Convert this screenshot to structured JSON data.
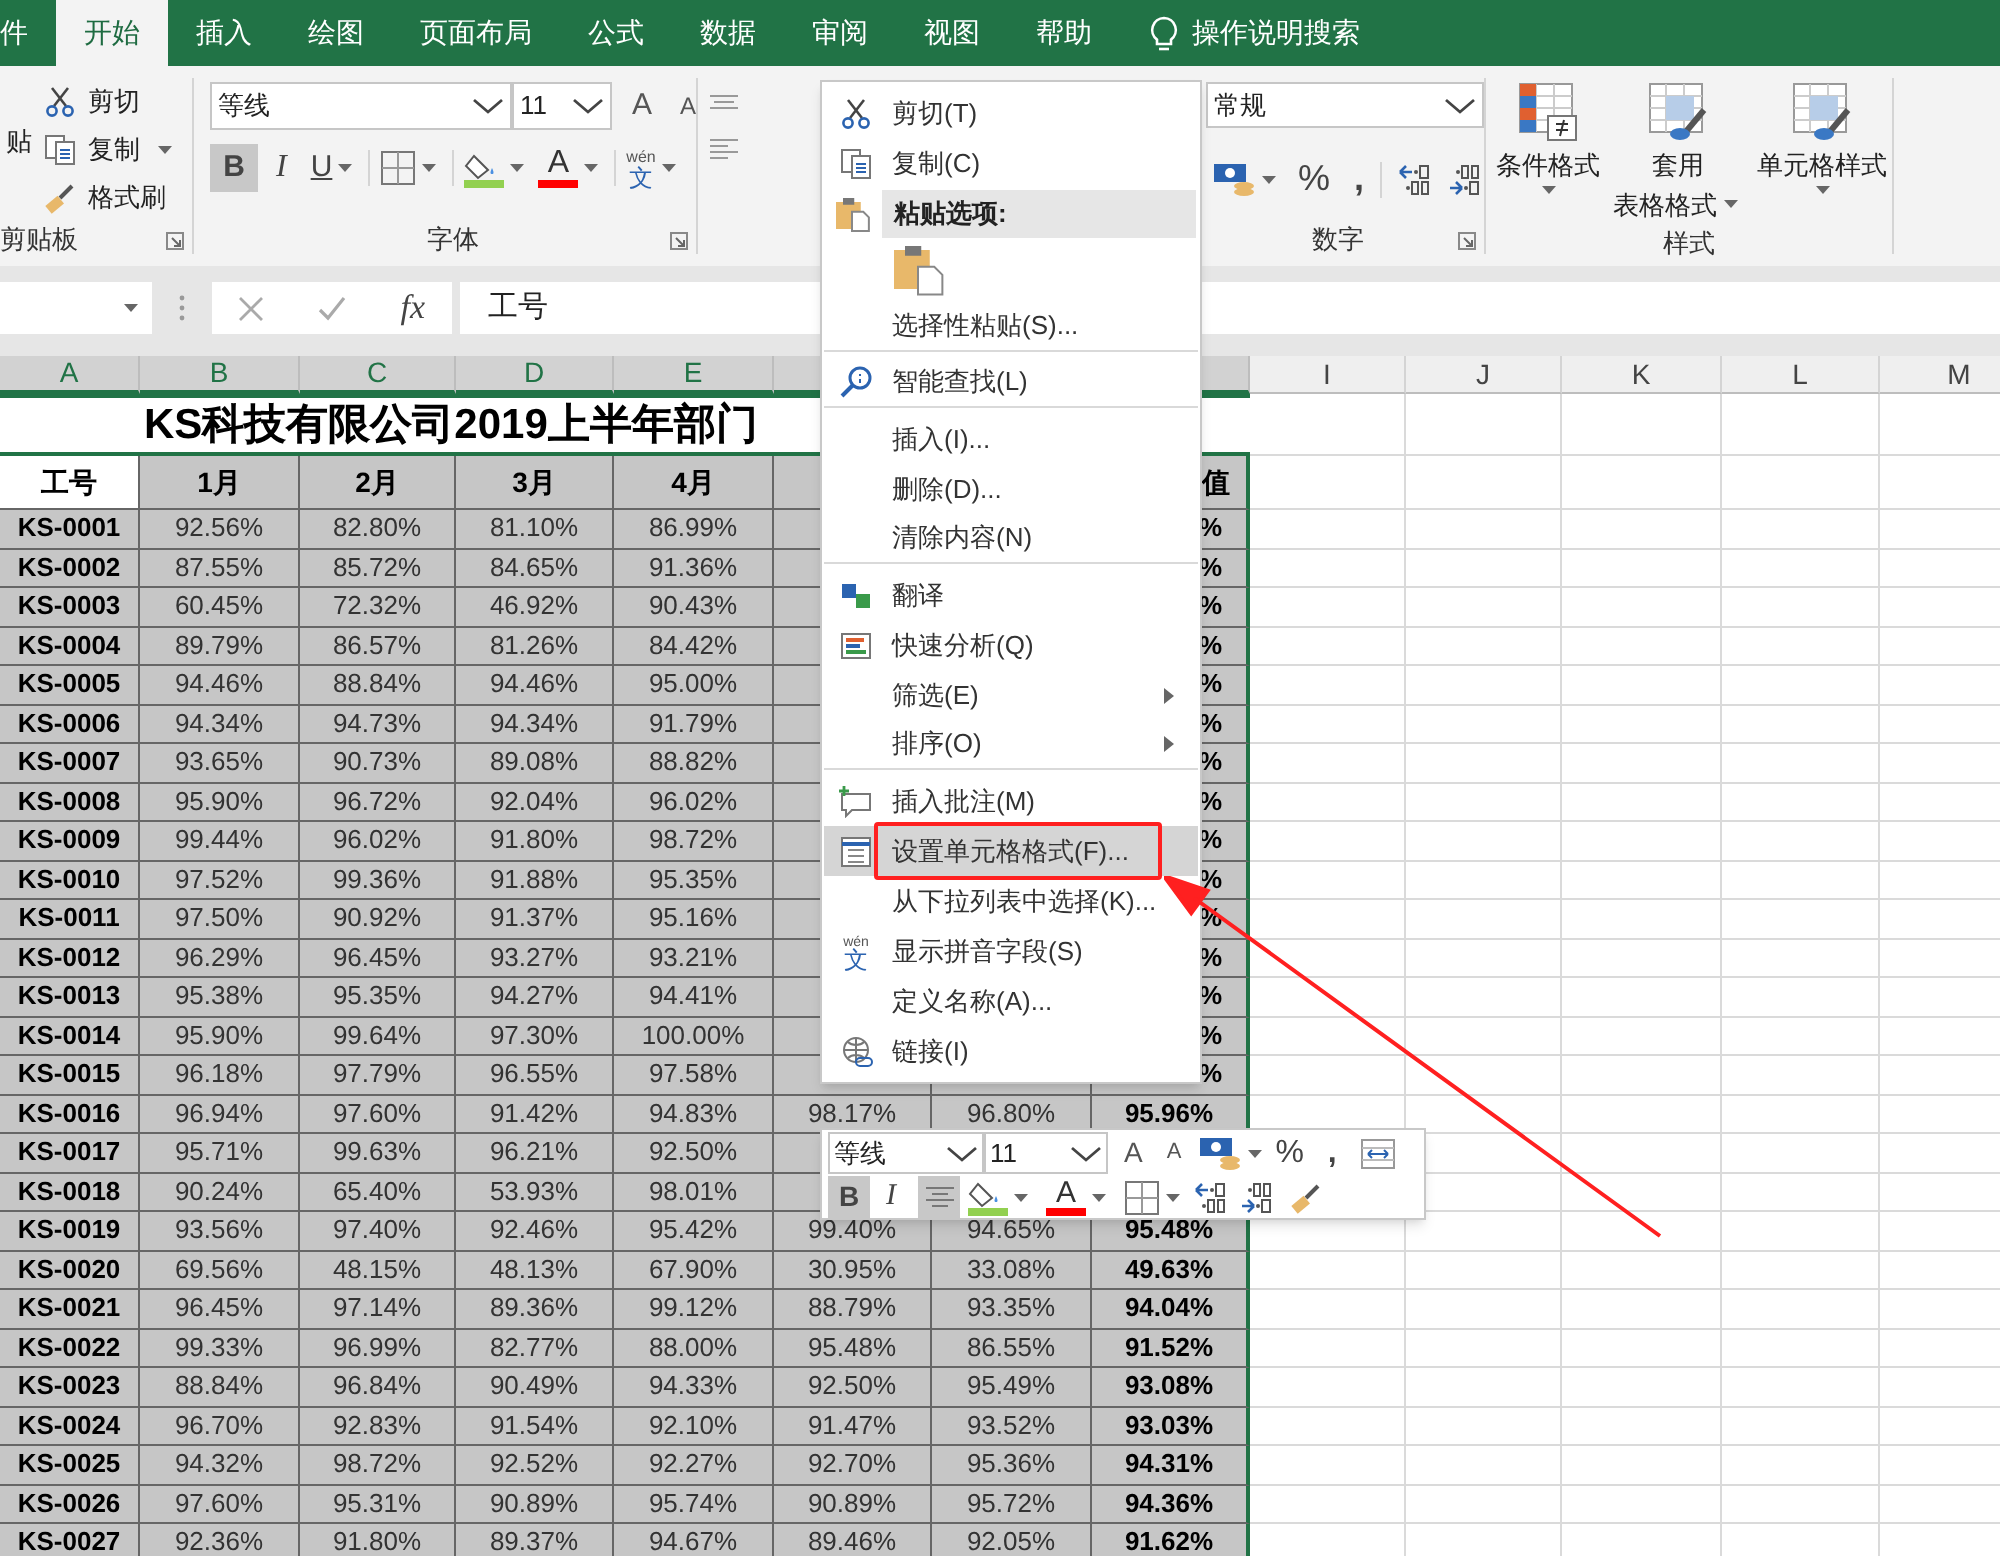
{
  "ribbon_tabs": [
    {
      "label": "件",
      "selected": false
    },
    {
      "label": "开始",
      "selected": true
    },
    {
      "label": "插入",
      "selected": false
    },
    {
      "label": "绘图",
      "selected": false
    },
    {
      "label": "页面布局",
      "selected": false
    },
    {
      "label": "公式",
      "selected": false
    },
    {
      "label": "数据",
      "selected": false
    },
    {
      "label": "审阅",
      "selected": false
    },
    {
      "label": "视图",
      "selected": false
    },
    {
      "label": "帮助",
      "selected": false
    }
  ],
  "tell_me": "操作说明搜索",
  "clipboard": {
    "paste": "贴",
    "cut": "剪切",
    "copy": "复制",
    "format_painter": "格式刷",
    "label": "剪贴板"
  },
  "font": {
    "name": "等线",
    "size": "11",
    "grow": "A",
    "shrink": "A",
    "bold": "B",
    "bold_active": true,
    "italic": "I",
    "underline": "U",
    "font_color": "A",
    "phonetic_reading": "wén",
    "phonetic": "文",
    "label": "字体"
  },
  "number": {
    "format": "常规",
    "percent": "%",
    "comma": ",",
    "label": "数字"
  },
  "styles": {
    "conditional": "条件格式",
    "table_format_1": "套用",
    "table_format_2": "表格格式",
    "cell_styles": "单元格样式",
    "label": "样式"
  },
  "formula_bar": {
    "fx": "fx",
    "value": "工号"
  },
  "column_headers_left": [
    {
      "label": "A",
      "selected": true
    },
    {
      "label": "B",
      "selected": true
    },
    {
      "label": "C",
      "selected": true
    },
    {
      "label": "D",
      "selected": true
    },
    {
      "label": "E",
      "selected": true
    }
  ],
  "column_headers_right": [
    {
      "label": "I",
      "selected": false
    },
    {
      "label": "J",
      "selected": false
    },
    {
      "label": "K",
      "selected": false
    },
    {
      "label": "L",
      "selected": false
    },
    {
      "label": "M",
      "selected": false
    }
  ],
  "sheet": {
    "title": "KS科技有限公司2019上半年部门",
    "header": [
      "工号",
      "1月",
      "2月",
      "3月",
      "4月"
    ],
    "header_tail": [
      "值"
    ],
    "rows": [
      {
        "cells": [
          "KS-0001",
          "92.56%",
          "82.80%",
          "81.10%",
          "86.99%"
        ],
        "tail": [
          "%"
        ]
      },
      {
        "cells": [
          "KS-0002",
          "87.55%",
          "85.72%",
          "84.65%",
          "91.36%"
        ],
        "tail": [
          "%"
        ]
      },
      {
        "cells": [
          "KS-0003",
          "60.45%",
          "72.32%",
          "46.92%",
          "90.43%"
        ],
        "tail": [
          "%"
        ]
      },
      {
        "cells": [
          "KS-0004",
          "89.79%",
          "86.57%",
          "81.26%",
          "84.42%"
        ],
        "tail": [
          "%"
        ]
      },
      {
        "cells": [
          "KS-0005",
          "94.46%",
          "88.84%",
          "94.46%",
          "95.00%"
        ],
        "tail": [
          "%"
        ]
      },
      {
        "cells": [
          "KS-0006",
          "94.34%",
          "94.73%",
          "94.34%",
          "91.79%"
        ],
        "tail": [
          "%"
        ]
      },
      {
        "cells": [
          "KS-0007",
          "93.65%",
          "90.73%",
          "89.08%",
          "88.82%"
        ],
        "tail": [
          "%"
        ]
      },
      {
        "cells": [
          "KS-0008",
          "95.90%",
          "96.72%",
          "92.04%",
          "96.02%"
        ],
        "tail": [
          "%"
        ]
      },
      {
        "cells": [
          "KS-0009",
          "99.44%",
          "96.02%",
          "91.80%",
          "98.72%"
        ],
        "tail": [
          "%"
        ]
      },
      {
        "cells": [
          "KS-0010",
          "97.52%",
          "99.36%",
          "91.88%",
          "95.35%"
        ],
        "tail": [
          "%"
        ]
      },
      {
        "cells": [
          "KS-0011",
          "97.50%",
          "90.92%",
          "91.37%",
          "95.16%"
        ],
        "tail": [
          "%"
        ]
      },
      {
        "cells": [
          "KS-0012",
          "96.29%",
          "96.45%",
          "93.27%",
          "93.21%"
        ],
        "tail": [
          "%"
        ]
      },
      {
        "cells": [
          "KS-0013",
          "95.38%",
          "95.35%",
          "94.27%",
          "94.41%"
        ],
        "tail": [
          "%"
        ]
      },
      {
        "cells": [
          "KS-0014",
          "95.90%",
          "99.64%",
          "97.30%",
          "100.00%"
        ],
        "tail": [
          "%"
        ]
      },
      {
        "cells": [
          "KS-0015",
          "96.18%",
          "97.79%",
          "96.55%",
          "97.58%"
        ],
        "tail": [
          "%"
        ]
      },
      {
        "cells": [
          "KS-0016",
          "96.94%",
          "97.60%",
          "91.42%",
          "94.83%"
        ],
        "tail": [
          "98.17%",
          "96.80%",
          "95.96%"
        ]
      },
      {
        "cells": [
          "KS-0017",
          "95.71%",
          "99.63%",
          "96.21%",
          "92.50%"
        ]
      },
      {
        "cells": [
          "KS-0018",
          "90.24%",
          "65.40%",
          "53.93%",
          "98.01%"
        ]
      },
      {
        "cells": [
          "KS-0019",
          "93.56%",
          "97.40%",
          "92.46%",
          "95.42%"
        ],
        "tail": [
          "99.40%",
          "94.65%",
          "95.48%"
        ]
      },
      {
        "cells": [
          "KS-0020",
          "69.56%",
          "48.15%",
          "48.13%",
          "67.90%"
        ],
        "tail": [
          "30.95%",
          "33.08%",
          "49.63%"
        ]
      },
      {
        "cells": [
          "KS-0021",
          "96.45%",
          "97.14%",
          "89.36%",
          "99.12%"
        ],
        "tail": [
          "88.79%",
          "93.35%",
          "94.04%"
        ]
      },
      {
        "cells": [
          "KS-0022",
          "99.33%",
          "96.99%",
          "82.77%",
          "88.00%"
        ],
        "tail": [
          "95.48%",
          "86.55%",
          "91.52%"
        ]
      },
      {
        "cells": [
          "KS-0023",
          "88.84%",
          "96.84%",
          "90.49%",
          "94.33%"
        ],
        "tail": [
          "92.50%",
          "95.49%",
          "93.08%"
        ]
      },
      {
        "cells": [
          "KS-0024",
          "96.70%",
          "92.83%",
          "91.54%",
          "92.10%"
        ],
        "tail": [
          "91.47%",
          "93.52%",
          "93.03%"
        ]
      },
      {
        "cells": [
          "KS-0025",
          "94.32%",
          "98.72%",
          "92.52%",
          "92.27%"
        ],
        "tail": [
          "92.70%",
          "95.36%",
          "94.31%"
        ]
      },
      {
        "cells": [
          "KS-0026",
          "97.60%",
          "95.31%",
          "90.89%",
          "95.74%"
        ],
        "tail": [
          "90.89%",
          "95.72%",
          "94.36%"
        ]
      },
      {
        "cells": [
          "KS-0027",
          "92.36%",
          "91.80%",
          "89.37%",
          "94.67%"
        ],
        "tail": [
          "89.46%",
          "92.05%",
          "91.62%"
        ]
      }
    ]
  },
  "context_menu": {
    "items": [
      {
        "kind": "command",
        "label": "剪切(T)",
        "selected": false,
        "separator_after": false,
        "submenu": false
      },
      {
        "kind": "command",
        "label": "复制(C)",
        "selected": false,
        "separator_after": false,
        "submenu": false
      },
      {
        "kind": "section",
        "label": "粘贴选项:",
        "selected": false,
        "separator_after": false
      },
      {
        "kind": "paste_option",
        "selected": false,
        "separator_after": false
      },
      {
        "kind": "command",
        "label": "选择性粘贴(S)...",
        "selected": false,
        "separator_after": true,
        "submenu": false
      },
      {
        "kind": "command",
        "label": "智能查找(L)",
        "selected": false,
        "separator_after": true,
        "submenu": false
      },
      {
        "kind": "command",
        "label": "插入(I)...",
        "selected": false,
        "separator_after": false,
        "submenu": false
      },
      {
        "kind": "command",
        "label": "删除(D)...",
        "selected": false,
        "separator_after": false,
        "submenu": false
      },
      {
        "kind": "command",
        "label": "清除内容(N)",
        "selected": false,
        "separator_after": true,
        "submenu": false
      },
      {
        "kind": "command",
        "label": "翻译",
        "selected": false,
        "separator_after": false,
        "submenu": false
      },
      {
        "kind": "command",
        "label": "快速分析(Q)",
        "selected": false,
        "separator_after": false,
        "submenu": false
      },
      {
        "kind": "command",
        "label": "筛选(E)",
        "selected": false,
        "separator_after": false,
        "submenu": true
      },
      {
        "kind": "command",
        "label": "排序(O)",
        "selected": false,
        "separator_after": true,
        "submenu": true
      },
      {
        "kind": "command",
        "label": "插入批注(M)",
        "selected": false,
        "separator_after": false,
        "submenu": false
      },
      {
        "kind": "command",
        "label": "设置单元格格式(F)...",
        "selected": true,
        "separator_after": false,
        "submenu": false
      },
      {
        "kind": "command",
        "label": "从下拉列表中选择(K)...",
        "selected": false,
        "separator_after": false,
        "submenu": false
      },
      {
        "kind": "command",
        "label": "显示拼音字段(S)",
        "selected": false,
        "separator_after": false,
        "submenu": false,
        "icon_reading": "wén",
        "icon_text": "文"
      },
      {
        "kind": "command",
        "label": "定义名称(A)...",
        "selected": false,
        "separator_after": false,
        "submenu": false
      },
      {
        "kind": "command",
        "label": "链接(I)",
        "selected": false,
        "separator_after": false,
        "submenu": false
      }
    ]
  },
  "mini_toolbar": {
    "font": "等线",
    "size": "11",
    "grow": "A",
    "shrink": "A",
    "percent": "%",
    "comma": ",",
    "bold": "B",
    "bold_active": true,
    "italic": "I",
    "center_active": true,
    "font_color": "A"
  }
}
